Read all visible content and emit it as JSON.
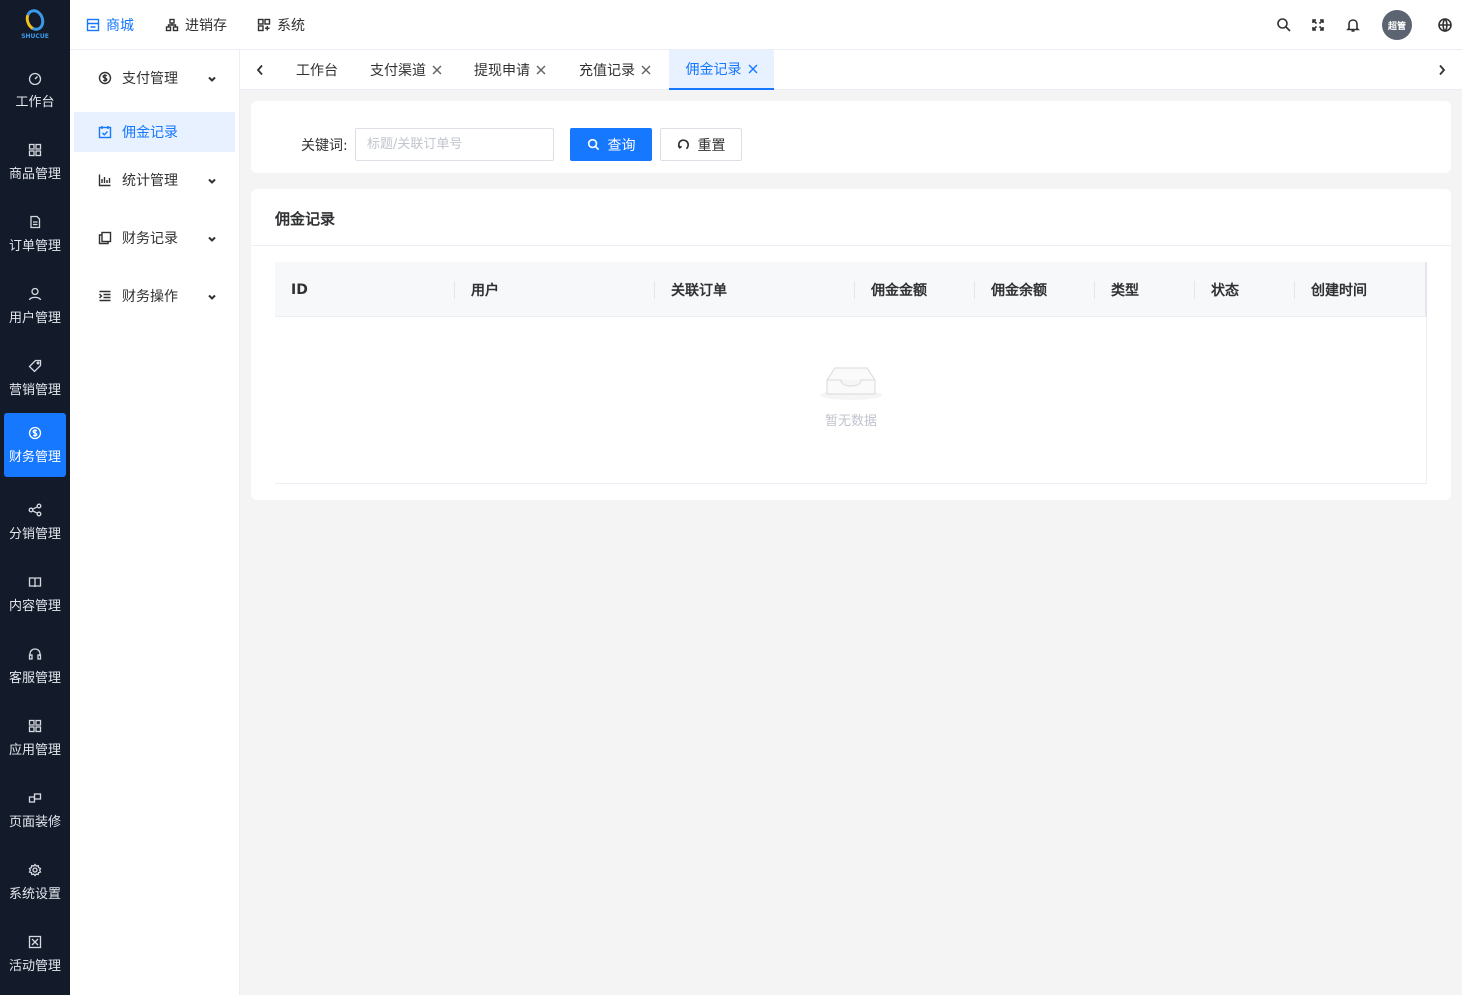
{
  "brand": {
    "logo_text": "SHUCUE"
  },
  "rail": {
    "items": [
      {
        "label": "工作台",
        "icon": "dashboard-icon"
      },
      {
        "label": "商品管理",
        "icon": "grid-icon"
      },
      {
        "label": "订单管理",
        "icon": "document-icon"
      },
      {
        "label": "用户管理",
        "icon": "user-icon"
      },
      {
        "label": "营销管理",
        "icon": "tag-icon"
      },
      {
        "label": "财务管理",
        "icon": "dollar-circle-icon",
        "active": true
      },
      {
        "label": "分销管理",
        "icon": "share-icon"
      },
      {
        "label": "内容管理",
        "icon": "book-icon"
      },
      {
        "label": "客服管理",
        "icon": "headset-icon"
      },
      {
        "label": "应用管理",
        "icon": "apps-icon"
      },
      {
        "label": "页面装修",
        "icon": "layout-icon"
      },
      {
        "label": "系统设置",
        "icon": "gear-icon"
      },
      {
        "label": "活动管理",
        "icon": "activity-icon"
      }
    ]
  },
  "topnav": {
    "items": [
      {
        "label": "商城",
        "icon": "store-icon",
        "active": true
      },
      {
        "label": "进销存",
        "icon": "network-icon"
      },
      {
        "label": "系统",
        "icon": "system-icon"
      }
    ],
    "avatar_text": "超管"
  },
  "subside": {
    "items": [
      {
        "label": "支付管理",
        "icon": "dollar-circle-icon",
        "expandable": true
      },
      {
        "label": "佣金记录",
        "icon": "calendar-check-icon",
        "active": true
      },
      {
        "label": "统计管理",
        "icon": "bar-chart-icon",
        "expandable": true
      },
      {
        "label": "财务记录",
        "icon": "copy-icon",
        "expandable": true
      },
      {
        "label": "财务操作",
        "icon": "indent-icon",
        "expandable": true
      }
    ]
  },
  "tabs": {
    "items": [
      {
        "label": "工作台",
        "closable": false
      },
      {
        "label": "支付渠道",
        "closable": true
      },
      {
        "label": "提现申请",
        "closable": true
      },
      {
        "label": "充值记录",
        "closable": true
      },
      {
        "label": "佣金记录",
        "closable": true,
        "active": true
      }
    ]
  },
  "search": {
    "keyword_label": "关键词:",
    "keyword_placeholder": "标题/关联订单号",
    "keyword_value": "",
    "query_label": "查询",
    "reset_label": "重置"
  },
  "table": {
    "title": "佣金记录",
    "columns": [
      "ID",
      "用户",
      "关联订单",
      "佣金金额",
      "佣金余额",
      "类型",
      "状态",
      "创建时间"
    ],
    "rows": [],
    "empty_text": "暂无数据"
  },
  "colors": {
    "primary": "#1677ff",
    "rail_bg": "#131b2b",
    "page_bg": "#f4f4f5"
  }
}
